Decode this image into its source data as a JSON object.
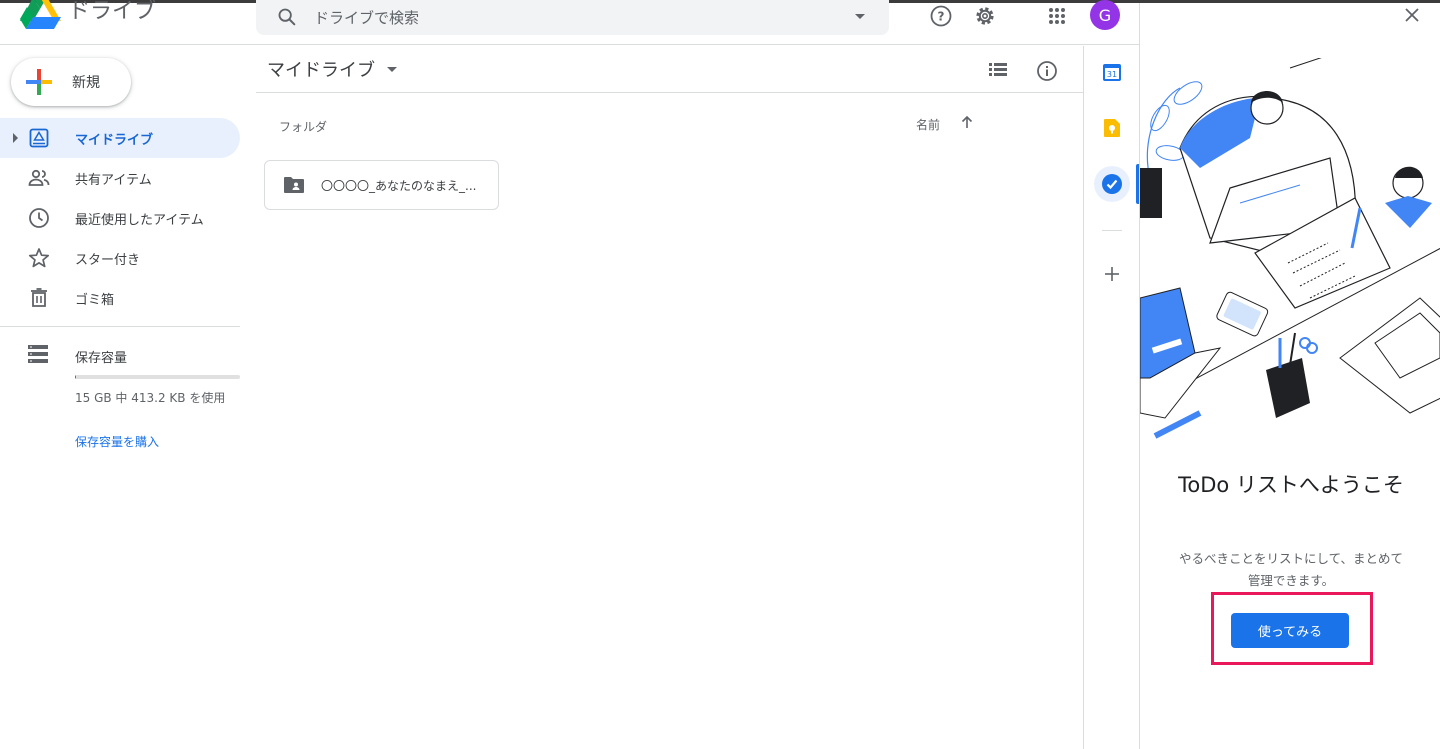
{
  "header": {
    "app_name": "ドライブ",
    "search_placeholder": "ドライブで検索",
    "avatar_letter": "G"
  },
  "sidebar": {
    "new_label": "新規",
    "items": [
      {
        "label": "マイドライブ",
        "icon": "my-drive-icon",
        "active": true
      },
      {
        "label": "共有アイテム",
        "icon": "shared-icon"
      },
      {
        "label": "最近使用したアイテム",
        "icon": "clock-icon"
      },
      {
        "label": "スター付き",
        "icon": "star-icon"
      },
      {
        "label": "ゴミ箱",
        "icon": "trash-icon"
      }
    ],
    "storage": {
      "label": "保存容量",
      "usage_text": "15 GB 中 413.2 KB を使用",
      "used_fraction": 0.0001,
      "buy_label": "保存容量を購入"
    }
  },
  "main": {
    "title": "マイドライブ",
    "section_label": "フォルダ",
    "sort_label": "名前",
    "folders": [
      {
        "name": "〇〇〇〇_あなたのなまえ_..."
      }
    ]
  },
  "tasks_panel": {
    "title": "ToDo リストへようこそ",
    "description": "やるべきことをリストにして、まとめて管理できます。",
    "button_label": "使ってみる"
  },
  "colors": {
    "accent": "#1a73e8",
    "active_bg": "#e8f0fe",
    "highlight": "#e8185a",
    "avatar": "#9334e6"
  }
}
